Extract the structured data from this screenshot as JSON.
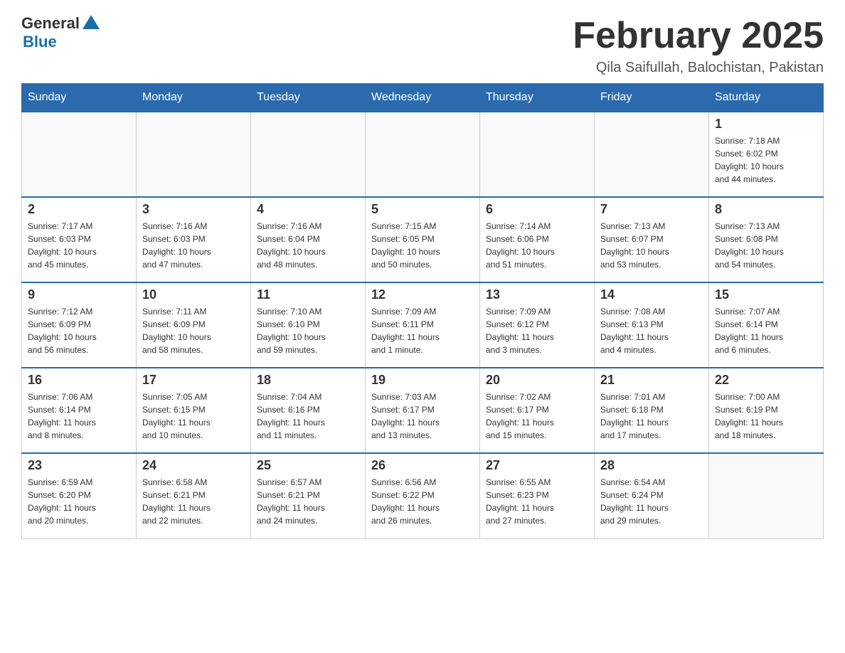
{
  "header": {
    "logo_general": "General",
    "logo_blue": "Blue",
    "title": "February 2025",
    "subtitle": "Qila Saifullah, Balochistan, Pakistan"
  },
  "weekdays": [
    "Sunday",
    "Monday",
    "Tuesday",
    "Wednesday",
    "Thursday",
    "Friday",
    "Saturday"
  ],
  "weeks": [
    [
      {
        "day": "",
        "info": ""
      },
      {
        "day": "",
        "info": ""
      },
      {
        "day": "",
        "info": ""
      },
      {
        "day": "",
        "info": ""
      },
      {
        "day": "",
        "info": ""
      },
      {
        "day": "",
        "info": ""
      },
      {
        "day": "1",
        "info": "Sunrise: 7:18 AM\nSunset: 6:02 PM\nDaylight: 10 hours\nand 44 minutes."
      }
    ],
    [
      {
        "day": "2",
        "info": "Sunrise: 7:17 AM\nSunset: 6:03 PM\nDaylight: 10 hours\nand 45 minutes."
      },
      {
        "day": "3",
        "info": "Sunrise: 7:16 AM\nSunset: 6:03 PM\nDaylight: 10 hours\nand 47 minutes."
      },
      {
        "day": "4",
        "info": "Sunrise: 7:16 AM\nSunset: 6:04 PM\nDaylight: 10 hours\nand 48 minutes."
      },
      {
        "day": "5",
        "info": "Sunrise: 7:15 AM\nSunset: 6:05 PM\nDaylight: 10 hours\nand 50 minutes."
      },
      {
        "day": "6",
        "info": "Sunrise: 7:14 AM\nSunset: 6:06 PM\nDaylight: 10 hours\nand 51 minutes."
      },
      {
        "day": "7",
        "info": "Sunrise: 7:13 AM\nSunset: 6:07 PM\nDaylight: 10 hours\nand 53 minutes."
      },
      {
        "day": "8",
        "info": "Sunrise: 7:13 AM\nSunset: 6:08 PM\nDaylight: 10 hours\nand 54 minutes."
      }
    ],
    [
      {
        "day": "9",
        "info": "Sunrise: 7:12 AM\nSunset: 6:09 PM\nDaylight: 10 hours\nand 56 minutes."
      },
      {
        "day": "10",
        "info": "Sunrise: 7:11 AM\nSunset: 6:09 PM\nDaylight: 10 hours\nand 58 minutes."
      },
      {
        "day": "11",
        "info": "Sunrise: 7:10 AM\nSunset: 6:10 PM\nDaylight: 10 hours\nand 59 minutes."
      },
      {
        "day": "12",
        "info": "Sunrise: 7:09 AM\nSunset: 6:11 PM\nDaylight: 11 hours\nand 1 minute."
      },
      {
        "day": "13",
        "info": "Sunrise: 7:09 AM\nSunset: 6:12 PM\nDaylight: 11 hours\nand 3 minutes."
      },
      {
        "day": "14",
        "info": "Sunrise: 7:08 AM\nSunset: 6:13 PM\nDaylight: 11 hours\nand 4 minutes."
      },
      {
        "day": "15",
        "info": "Sunrise: 7:07 AM\nSunset: 6:14 PM\nDaylight: 11 hours\nand 6 minutes."
      }
    ],
    [
      {
        "day": "16",
        "info": "Sunrise: 7:06 AM\nSunset: 6:14 PM\nDaylight: 11 hours\nand 8 minutes."
      },
      {
        "day": "17",
        "info": "Sunrise: 7:05 AM\nSunset: 6:15 PM\nDaylight: 11 hours\nand 10 minutes."
      },
      {
        "day": "18",
        "info": "Sunrise: 7:04 AM\nSunset: 6:16 PM\nDaylight: 11 hours\nand 11 minutes."
      },
      {
        "day": "19",
        "info": "Sunrise: 7:03 AM\nSunset: 6:17 PM\nDaylight: 11 hours\nand 13 minutes."
      },
      {
        "day": "20",
        "info": "Sunrise: 7:02 AM\nSunset: 6:17 PM\nDaylight: 11 hours\nand 15 minutes."
      },
      {
        "day": "21",
        "info": "Sunrise: 7:01 AM\nSunset: 6:18 PM\nDaylight: 11 hours\nand 17 minutes."
      },
      {
        "day": "22",
        "info": "Sunrise: 7:00 AM\nSunset: 6:19 PM\nDaylight: 11 hours\nand 18 minutes."
      }
    ],
    [
      {
        "day": "23",
        "info": "Sunrise: 6:59 AM\nSunset: 6:20 PM\nDaylight: 11 hours\nand 20 minutes."
      },
      {
        "day": "24",
        "info": "Sunrise: 6:58 AM\nSunset: 6:21 PM\nDaylight: 11 hours\nand 22 minutes."
      },
      {
        "day": "25",
        "info": "Sunrise: 6:57 AM\nSunset: 6:21 PM\nDaylight: 11 hours\nand 24 minutes."
      },
      {
        "day": "26",
        "info": "Sunrise: 6:56 AM\nSunset: 6:22 PM\nDaylight: 11 hours\nand 26 minutes."
      },
      {
        "day": "27",
        "info": "Sunrise: 6:55 AM\nSunset: 6:23 PM\nDaylight: 11 hours\nand 27 minutes."
      },
      {
        "day": "28",
        "info": "Sunrise: 6:54 AM\nSunset: 6:24 PM\nDaylight: 11 hours\nand 29 minutes."
      },
      {
        "day": "",
        "info": ""
      }
    ]
  ]
}
